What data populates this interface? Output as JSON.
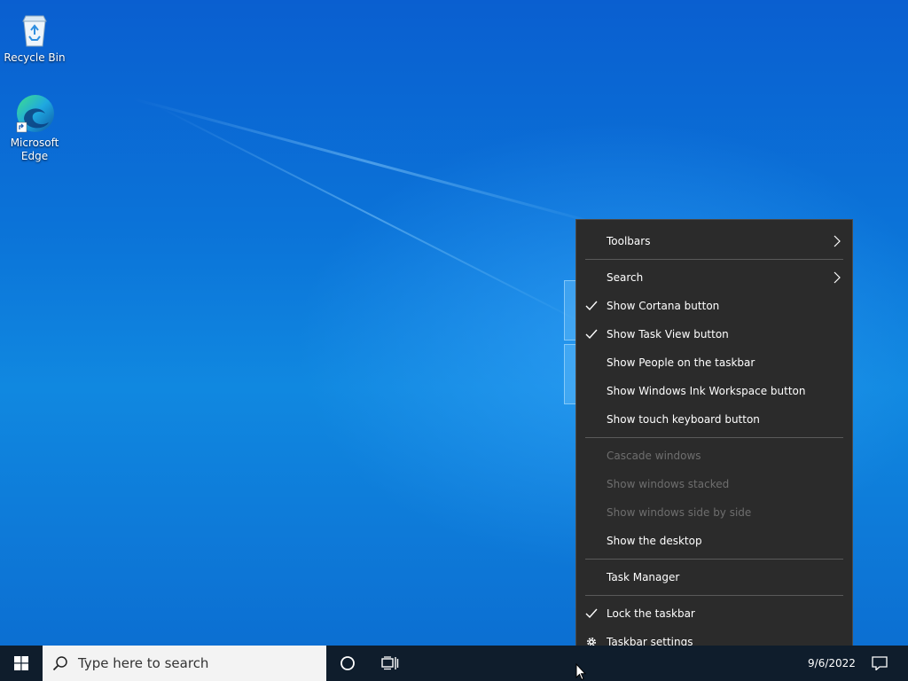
{
  "desktop": {
    "icons": [
      {
        "label": "Recycle Bin",
        "icon": "recycle-bin-icon"
      },
      {
        "label": "Microsoft Edge",
        "icon": "edge-icon"
      }
    ]
  },
  "taskbar": {
    "search_placeholder": "Type here to search",
    "clock_date": "9/6/2022",
    "icons": {
      "start": "windows-logo-icon",
      "search": "search-icon",
      "cortana": "cortana-circle-icon",
      "task_view": "task-view-icon",
      "action_center": "notification-icon"
    }
  },
  "context_menu": {
    "toolbars": "Toolbars",
    "search": "Search",
    "show_cortana": "Show Cortana button",
    "show_task_view": "Show Task View button",
    "show_people": "Show People on the taskbar",
    "show_ink": "Show Windows Ink Workspace button",
    "show_touch_keyboard": "Show touch keyboard button",
    "cascade": "Cascade windows",
    "stacked": "Show windows stacked",
    "side_by_side": "Show windows side by side",
    "show_desktop": "Show the desktop",
    "task_manager": "Task Manager",
    "lock_taskbar": "Lock the taskbar",
    "taskbar_settings": "Taskbar settings",
    "checked": {
      "show_cortana": true,
      "show_task_view": true,
      "lock_taskbar": true
    },
    "disabled": [
      "cascade",
      "stacked",
      "side_by_side"
    ]
  },
  "colors": {
    "menu_bg": "#2b2b2b",
    "taskbar_bg": "#0f1d2c",
    "desktop_accent": "#0b73d8",
    "disabled_text": "#6e6e6e"
  }
}
